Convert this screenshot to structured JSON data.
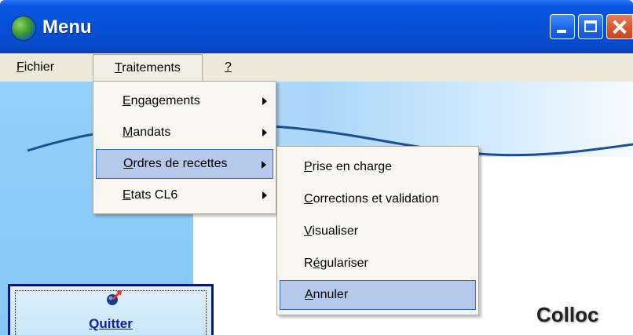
{
  "window": {
    "title": "Menu",
    "icon": "globe-icon",
    "controls": [
      "minimize-icon",
      "maximize-icon",
      "close-icon"
    ],
    "accent": "#0a55e0"
  },
  "menubar": {
    "items": [
      {
        "prefix": "",
        "mnemonic": "F",
        "rest": "ichier"
      },
      {
        "prefix": "",
        "mnemonic": "T",
        "rest": "raitements"
      },
      {
        "prefix": "",
        "mnemonic": "?",
        "rest": ""
      }
    ]
  },
  "traitements_menu": {
    "items": [
      {
        "prefix": "",
        "mnemonic": "E",
        "rest": "ngagements",
        "submenu": true
      },
      {
        "prefix": "",
        "mnemonic": "M",
        "rest": "andats",
        "submenu": true
      },
      {
        "prefix": "",
        "mnemonic": "O",
        "rest": "rdres de recettes",
        "submenu": true,
        "highlighted": true
      },
      {
        "prefix": "",
        "mnemonic": "E",
        "rest": "tats CL6",
        "submenu": true
      }
    ]
  },
  "ordres_submenu": {
    "items": [
      {
        "prefix": "",
        "mnemonic": "P",
        "rest": "rise en charge"
      },
      {
        "prefix": "",
        "mnemonic": "C",
        "rest": "orrections et validation"
      },
      {
        "prefix": "",
        "mnemonic": "V",
        "rest": "isualiser"
      },
      {
        "prefix": "R",
        "mnemonic": "é",
        "rest": "gulariser"
      },
      {
        "prefix": "",
        "mnemonic": "A",
        "rest": "nnuler",
        "highlighted": true
      }
    ]
  },
  "quit_button": {
    "label": "Quitter",
    "icon": "exit-arrow-icon"
  },
  "brand": {
    "text": "Colloc"
  },
  "colors": {
    "highlight": "#b6c9ea",
    "highlight_border": "#316ac5",
    "menu_bg": "#ece9d8"
  }
}
